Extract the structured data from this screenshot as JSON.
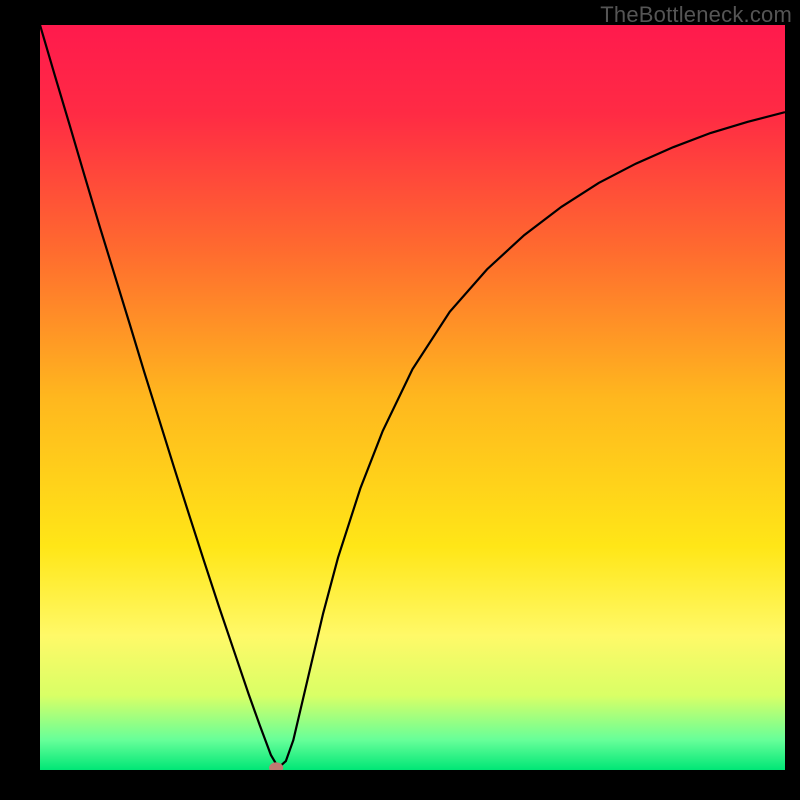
{
  "watermark": "TheBottleneck.com",
  "chart_data": {
    "type": "line",
    "title": "",
    "xlabel": "",
    "ylabel": "",
    "xlim": [
      0,
      100
    ],
    "ylim": [
      0,
      100
    ],
    "background_gradient": {
      "stops": [
        {
          "offset": 0.0,
          "color": "#ff1a4d"
        },
        {
          "offset": 0.12,
          "color": "#ff2b44"
        },
        {
          "offset": 0.3,
          "color": "#ff6a2f"
        },
        {
          "offset": 0.5,
          "color": "#ffb71e"
        },
        {
          "offset": 0.7,
          "color": "#ffe617"
        },
        {
          "offset": 0.82,
          "color": "#fff968"
        },
        {
          "offset": 0.9,
          "color": "#d9ff66"
        },
        {
          "offset": 0.96,
          "color": "#66ff99"
        },
        {
          "offset": 1.0,
          "color": "#00e676"
        }
      ]
    },
    "curve": {
      "color": "#000000",
      "stroke_width": 2.2,
      "x": [
        0,
        2,
        4,
        6,
        8,
        10,
        12,
        14,
        16,
        18,
        20,
        22,
        24,
        26,
        28,
        29.5,
        31,
        32,
        33,
        34,
        36,
        38,
        40,
        43,
        46,
        50,
        55,
        60,
        65,
        70,
        75,
        80,
        85,
        90,
        95,
        100
      ],
      "y": [
        100,
        93.2,
        86.5,
        79.7,
        73.0,
        66.5,
        60.0,
        53.4,
        47.0,
        40.6,
        34.3,
        28.1,
        22.0,
        16.1,
        10.2,
        6.0,
        2.0,
        0.3,
        1.2,
        4.0,
        12.5,
        21.0,
        28.5,
        37.8,
        45.5,
        53.8,
        61.5,
        67.2,
        71.8,
        75.6,
        78.8,
        81.4,
        83.6,
        85.5,
        87.0,
        88.3
      ]
    },
    "marker": {
      "x": 31.7,
      "y": 0.3,
      "rx": 0.95,
      "ry": 0.72,
      "fill": "#c07a72"
    }
  }
}
